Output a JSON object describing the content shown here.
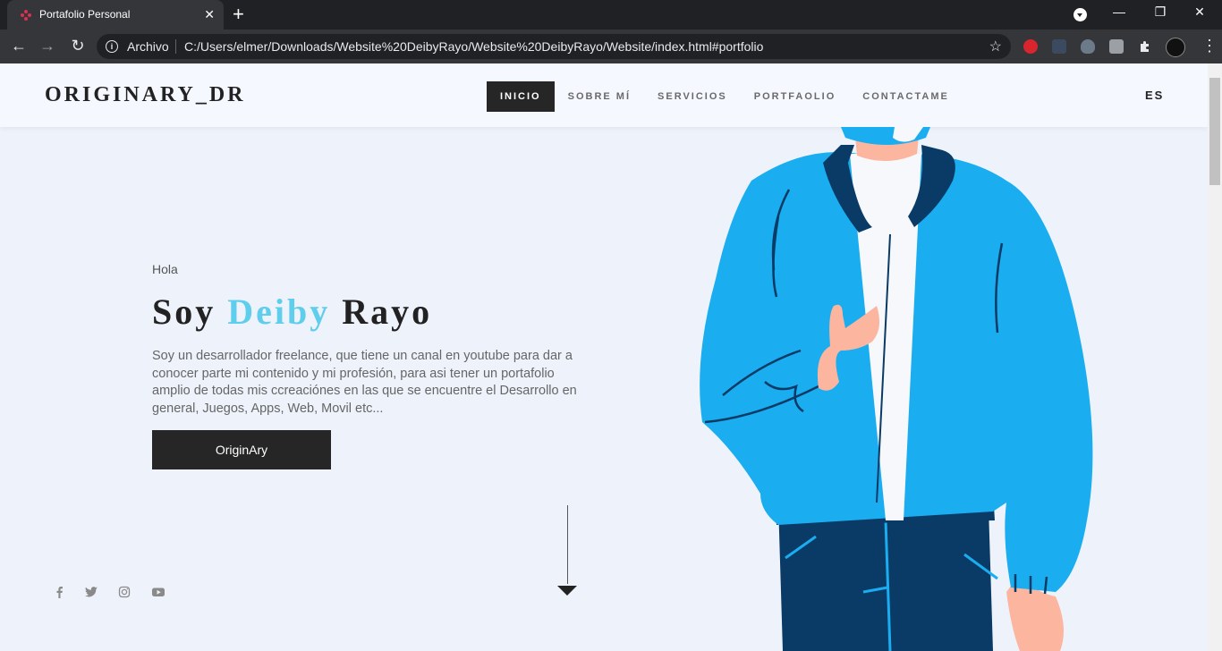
{
  "browser": {
    "tab_title": "Portafolio Personal",
    "tab_close": "✕",
    "new_tab": "+",
    "omnibox_label": "Archivo",
    "url": "C:/Users/elmer/Downloads/Website%20DeibyRayo/Website%20DeibyRayo/Website/index.html#portfolio",
    "icons": [
      "back-icon",
      "forward-icon",
      "reload-icon",
      "info-icon",
      "star-icon",
      "mega-extension-icon",
      "extension-icon",
      "cat-extension-icon",
      "pdf-extension-icon",
      "puzzle-icon",
      "avatar-icon",
      "menu-icon"
    ],
    "window_controls": [
      "—",
      "❐",
      "✕"
    ],
    "nav": [
      "←",
      "→",
      "↻"
    ],
    "star": "☆",
    "kebab": "⋮"
  },
  "site": {
    "logo": "ORIGINARY_DR",
    "menu": [
      "INICIO",
      "SOBRE MÍ",
      "SERVICIOS",
      "PORTFAOLIO",
      "CONTACTAME"
    ],
    "active_menu": "INICIO",
    "lang": "ES"
  },
  "hero": {
    "greeting": "Hola",
    "title_pre": "Soy ",
    "title_accent": "Deiby",
    "title_post": " Rayo",
    "description": "Soy un desarrollador freelance, que tiene un canal en youtube para dar a conocer parte mi contenido y mi profesión, para asi tener un portafolio amplio de todas mis ccreaciónes en las que se encuentre el Desarrollo en general, Juegos, Apps, Web, Movil etc...",
    "cta": "OriginAry"
  },
  "social": [
    "facebook-icon",
    "twitter-icon",
    "instagram-icon",
    "youtube-icon"
  ],
  "colors": {
    "accent": "#5fcdec",
    "page_bg": "#eef2fb",
    "button_bg": "#262626",
    "jacket": "#1aadf0",
    "jeans": "#0a3a66"
  }
}
